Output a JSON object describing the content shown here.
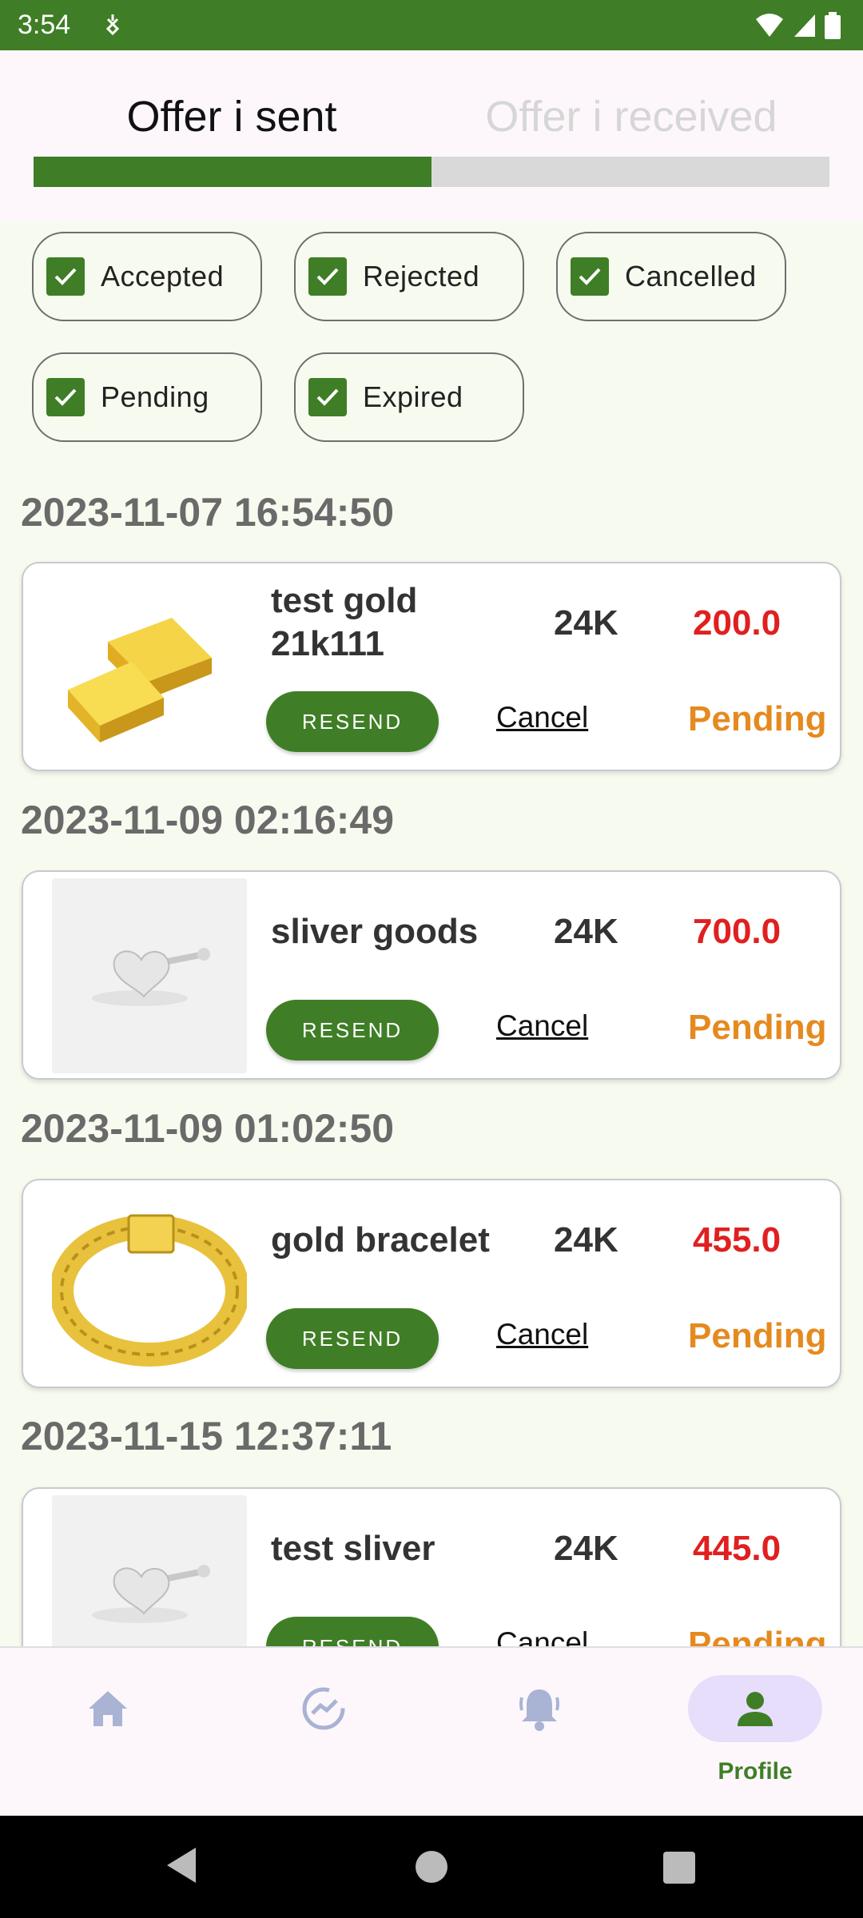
{
  "status_bar": {
    "time": "3:54"
  },
  "tabs": [
    {
      "label": "Offer i sent",
      "active": true
    },
    {
      "label": "Offer i received",
      "active": false
    }
  ],
  "filters": [
    {
      "label": "Accepted",
      "checked": true
    },
    {
      "label": "Rejected",
      "checked": true
    },
    {
      "label": "Cancelled",
      "checked": true
    },
    {
      "label": "Pending",
      "checked": true
    },
    {
      "label": "Expired",
      "checked": true
    }
  ],
  "offers": [
    {
      "date": "2023-11-07 16:54:50",
      "name": "test gold 21k111",
      "karat": "24K",
      "price": "200.0",
      "resend": "RESEND",
      "cancel": "Cancel",
      "status": "Pending",
      "image": "gold-bars"
    },
    {
      "date": "2023-11-09 02:16:49",
      "name": "sliver goods",
      "karat": "24K",
      "price": "700.0",
      "resend": "RESEND",
      "cancel": "Cancel",
      "status": "Pending",
      "image": "silver-heart-earring"
    },
    {
      "date": "2023-11-09 01:02:50",
      "name": "gold bracelet",
      "karat": "24K",
      "price": "455.0",
      "resend": "RESEND",
      "cancel": "Cancel",
      "status": "Pending",
      "image": "gold-bracelet"
    },
    {
      "date": "2023-11-15 12:37:11",
      "name": "test sliver",
      "karat": "24K",
      "price": "445.0",
      "resend": "RESEND",
      "cancel": "Cancel",
      "status": "Pending",
      "image": "silver-heart-earring"
    }
  ],
  "bottom_nav": {
    "items": [
      {
        "icon": "home-icon"
      },
      {
        "icon": "trend-icon"
      },
      {
        "icon": "bell-icon"
      },
      {
        "icon": "person-icon",
        "label": "Profile",
        "active": true
      }
    ]
  },
  "colors": {
    "primary": "#3f7e26",
    "price": "#e02020",
    "pending": "#e58a1f"
  }
}
